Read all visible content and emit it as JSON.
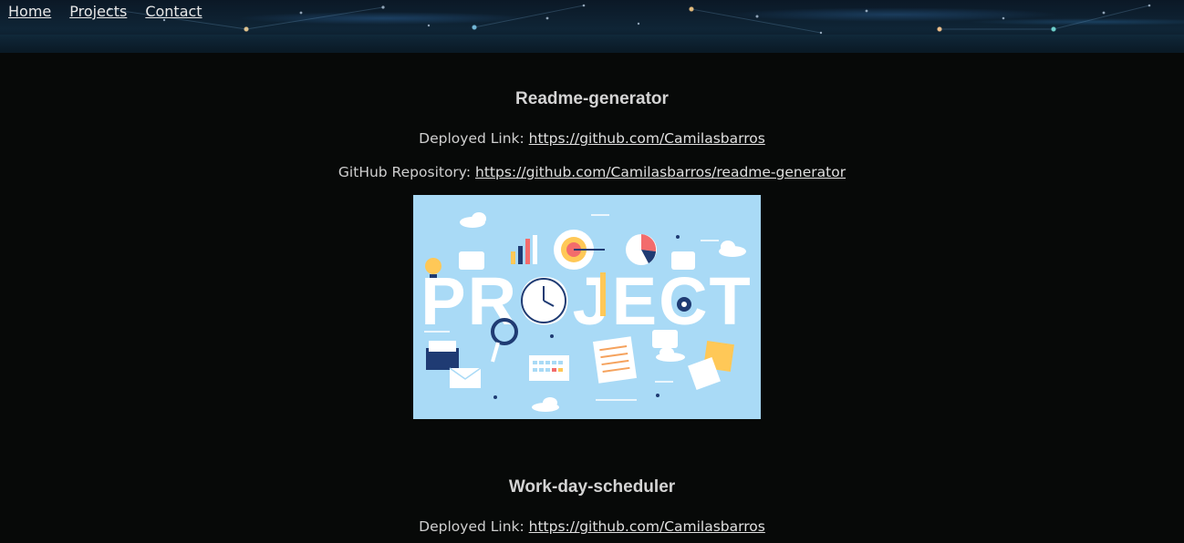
{
  "nav": {
    "items": [
      {
        "label": "Home"
      },
      {
        "label": "Projects"
      },
      {
        "label": "Contact"
      }
    ]
  },
  "projects": [
    {
      "title": "Readme-generator",
      "deployed_label": "Deployed Link:",
      "deployed_url": "https://github.com/Camilasbarros",
      "repo_label": "GitHub Repository:",
      "repo_url": "https://github.com/Camilasbarros/readme-generator",
      "image_word": "PROJECT"
    },
    {
      "title": "Work-day-scheduler",
      "deployed_label": "Deployed Link:",
      "deployed_url": "https://github.com/Camilasbarros"
    }
  ],
  "colors": {
    "background": "#070908",
    "image_bg": "#a9daf6",
    "text": "#d6d6d6"
  }
}
